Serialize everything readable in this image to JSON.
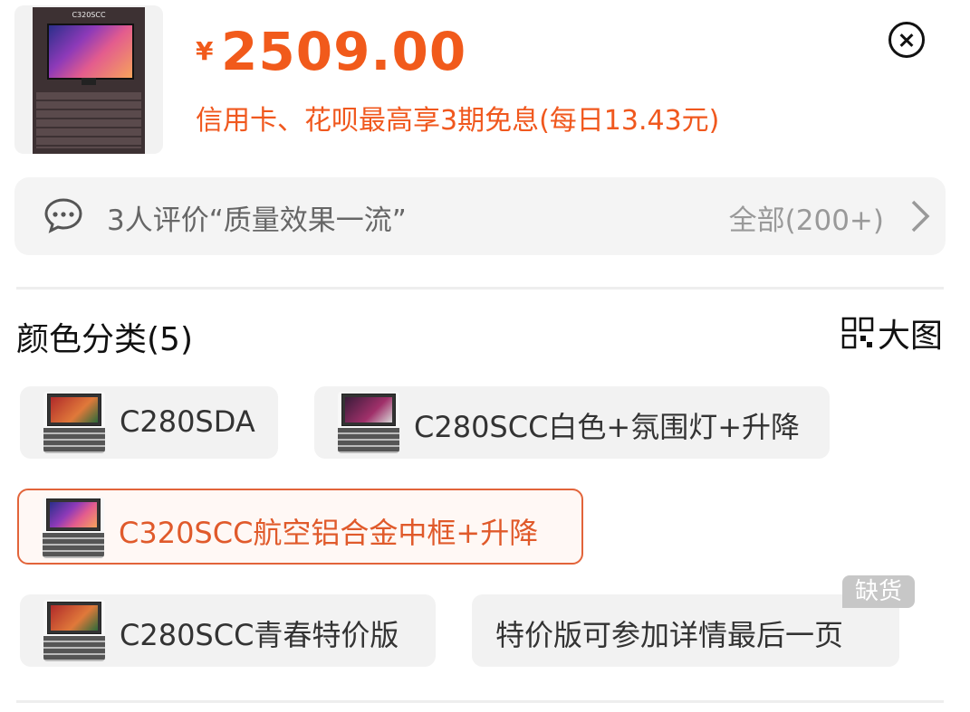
{
  "product": {
    "thumbnail_title": "C320SCC",
    "price_symbol": "¥",
    "price": "2509.00",
    "installment": "信用卡、花呗最高享3期免息(每日13.43元)"
  },
  "review": {
    "text": "3人评价“质量效果一流”",
    "all_label": "全部(200+)"
  },
  "section": {
    "title": "颜色分类(5)",
    "big_image_label": "大图"
  },
  "options": [
    {
      "label": "C280SDA",
      "selected": false
    },
    {
      "label": "C280SCC白色+氛围灯+升降",
      "selected": false
    },
    {
      "label": "C320SCC航空铝合金中框+升降",
      "selected": true
    },
    {
      "label": "C280SCC青春特价版",
      "selected": false
    },
    {
      "label": "特价版可参加详情最后一页",
      "selected": false,
      "badge": "缺货"
    }
  ],
  "colors": {
    "accent": "#f15a1b",
    "selected_border": "#e2643a",
    "badge_bg": "#c7c7c7"
  },
  "icons": {
    "close": "close-circle-icon",
    "review": "chat-bubble-icon",
    "more": "chevron-right-icon",
    "big_image": "grid-view-icon"
  }
}
